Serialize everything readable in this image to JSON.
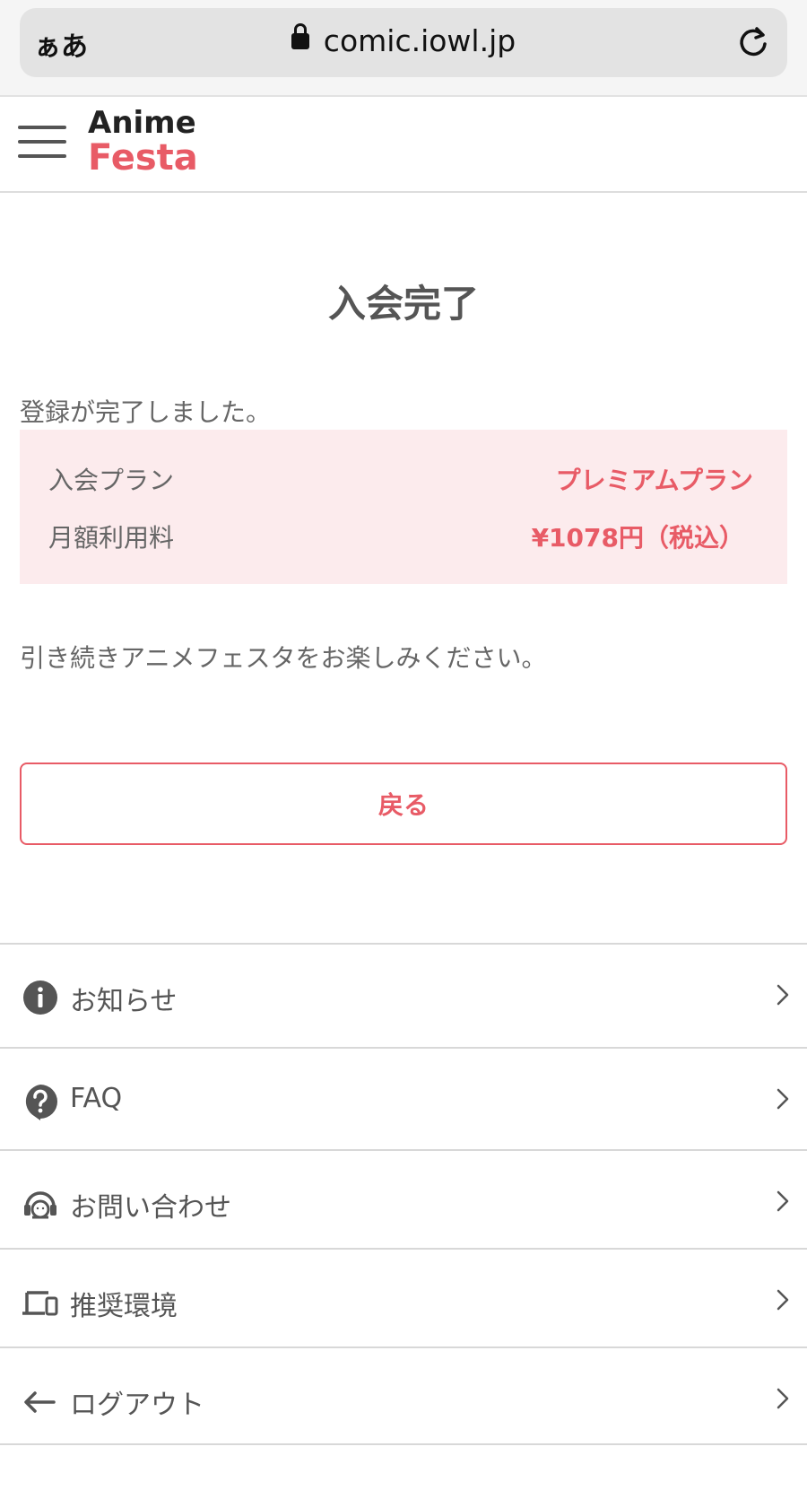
{
  "browser": {
    "aa_label": "ぁあ",
    "url": "comic.iowl.jp"
  },
  "header": {
    "logo_line1": "Anime",
    "logo_line2": "Festa"
  },
  "main": {
    "title": "入会完了",
    "complete_message": "登録が完了しました。",
    "plan": {
      "plan_label": "入会プラン",
      "plan_value": "プレミアムプラン",
      "fee_label": "月額利用料",
      "fee_value": "¥1078円（税込）"
    },
    "enjoy_message": "引き続きアニメフェスタをお楽しみください。",
    "back_button": "戻る"
  },
  "menu": {
    "items": [
      {
        "label": "お知らせ",
        "icon": "info-icon"
      },
      {
        "label": "FAQ",
        "icon": "question-icon"
      },
      {
        "label": "お問い合わせ",
        "icon": "headset-icon"
      },
      {
        "label": "推奨環境",
        "icon": "devices-icon"
      },
      {
        "label": "ログアウト",
        "icon": "arrow-left-icon"
      }
    ]
  },
  "colors": {
    "accent": "#e85b66",
    "plan_bg": "#fcebed",
    "text": "#555555"
  }
}
